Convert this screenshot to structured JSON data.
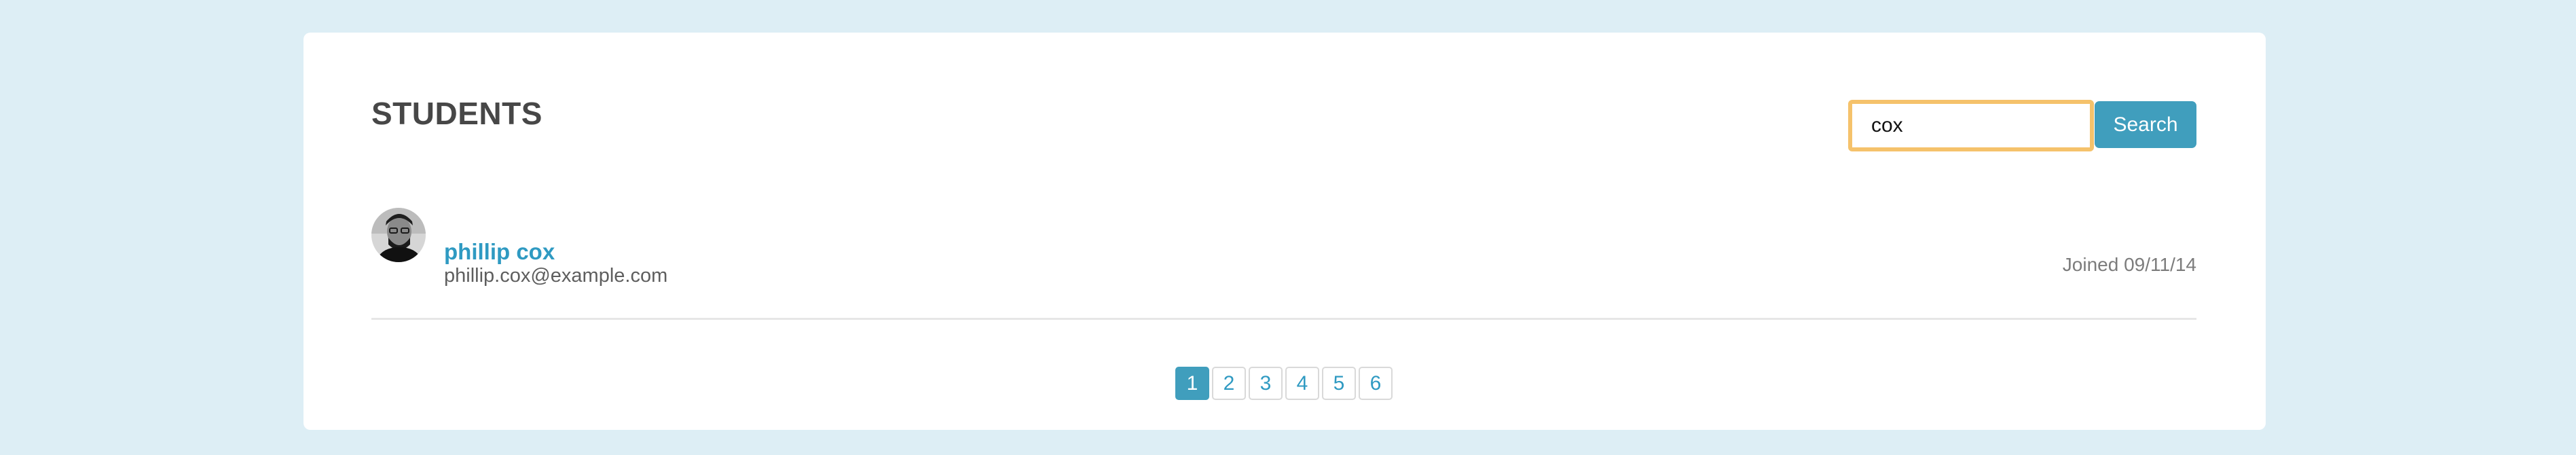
{
  "header": {
    "title": "STUDENTS"
  },
  "search": {
    "value": "cox",
    "button_label": "Search"
  },
  "students": [
    {
      "name": "phillip cox",
      "email": "phillip.cox@example.com",
      "joined": "Joined 09/11/14"
    }
  ],
  "pagination": {
    "pages": [
      "1",
      "2",
      "3",
      "4",
      "5",
      "6"
    ],
    "current": "1"
  },
  "colors": {
    "background": "#ddeef5",
    "accent": "#409ebd",
    "link": "#2f9ac2",
    "focus_border": "#f5c26b"
  }
}
